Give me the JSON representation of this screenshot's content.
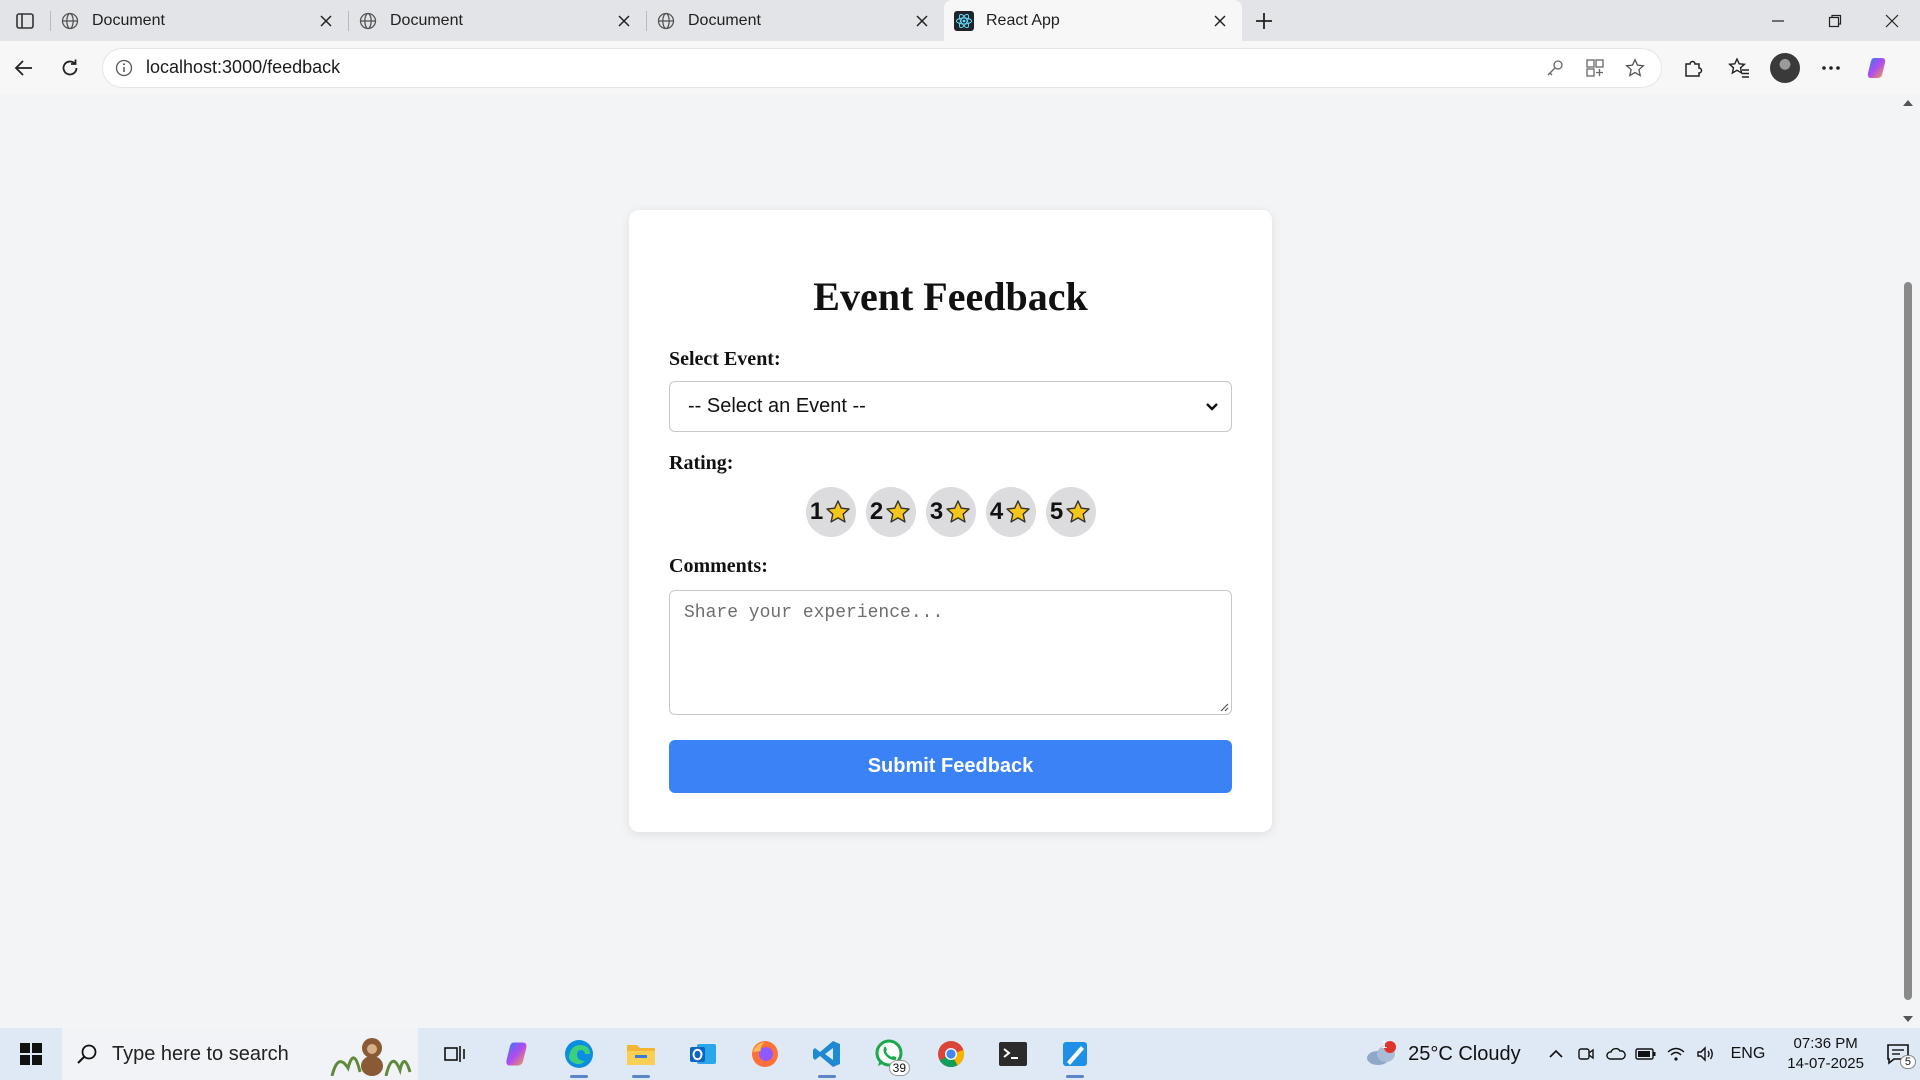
{
  "browser": {
    "tabs": [
      {
        "title": "Document",
        "active": false
      },
      {
        "title": "Document",
        "active": false
      },
      {
        "title": "Document",
        "active": false
      },
      {
        "title": "React App",
        "active": true
      }
    ],
    "url": "localhost:3000/feedback"
  },
  "page": {
    "title": "Event Feedback",
    "event_label": "Select Event:",
    "event_select_value": "-- Select an Event --",
    "rating_label": "Rating:",
    "rating_options": [
      "1",
      "2",
      "3",
      "4",
      "5"
    ],
    "comments_label": "Comments:",
    "comments_placeholder": "Share your experience...",
    "submit_label": "Submit Feedback"
  },
  "taskbar": {
    "search_placeholder": "Type here to search",
    "whatsapp_badge": "39",
    "weather_alert": "1",
    "weather": "25°C  Cloudy",
    "language": "ENG",
    "time": "07:36 PM",
    "date": "14-07-2025",
    "notification_count": "5"
  },
  "colors": {
    "accent": "#3b82f6",
    "page_bg": "#f3f4f6",
    "star_fill": "#f5c518"
  }
}
